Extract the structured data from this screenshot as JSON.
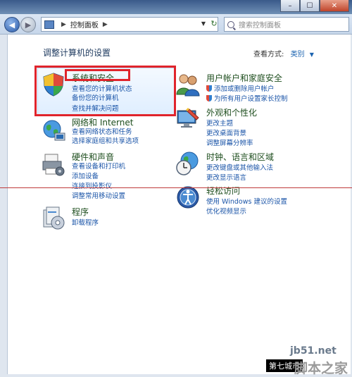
{
  "window": {
    "close_glyph": "✕",
    "min_glyph": "–",
    "max_glyph": "☐"
  },
  "nav": {
    "back_glyph": "◀",
    "forward_glyph": "▶",
    "breadcrumb": "控制面板",
    "breadcrumb_sep": "▶",
    "dropdown_glyph": "▼",
    "refresh_glyph": "↻",
    "search_placeholder": "搜索控制面板"
  },
  "main": {
    "title": "调整计算机的设置",
    "view_by_label": "查看方式:",
    "view_by_value": "类别",
    "view_by_arrow": "▼"
  },
  "categories": [
    {
      "title": "系统和安全",
      "links": [
        "查看您的计算机状态",
        "备份您的计算机",
        "查找并解决问题"
      ]
    },
    {
      "title": "网络和 Internet",
      "links": [
        "查看网络状态和任务",
        "选择家庭组和共享选项"
      ]
    },
    {
      "title": "硬件和声音",
      "links": [
        "查看设备和打印机",
        "添加设备",
        "连接到投影仪",
        "调整常用移动设置"
      ]
    },
    {
      "title": "程序",
      "links": [
        "卸载程序"
      ]
    },
    {
      "title": "用户帐户和家庭安全",
      "links": [
        "添加或删除用户帐户",
        "为所有用户设置家长控制"
      ]
    },
    {
      "title": "外观和个性化",
      "links": [
        "更改主题",
        "更改桌面背景",
        "调整屏幕分辨率"
      ]
    },
    {
      "title": "时钟、语言和区域",
      "links": [
        "更改键盘或其他输入法",
        "更改显示语言"
      ]
    },
    {
      "title": "轻松访问",
      "links": [
        "使用 Windows 建议的设置",
        "优化视频显示"
      ]
    }
  ],
  "watermark": {
    "site": "jb51.net",
    "label": "第七城市",
    "brand": "脚本之家"
  },
  "colors": {
    "highlight": "#e0242c",
    "link": "#1b55a8"
  }
}
